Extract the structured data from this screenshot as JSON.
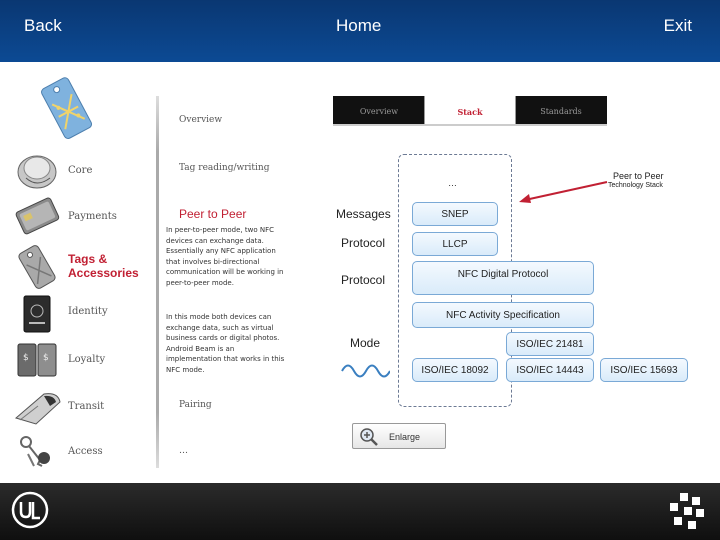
{
  "nav": {
    "back": "Back",
    "home": "Home",
    "exit": "Exit"
  },
  "sidebar": {
    "items": [
      {
        "label": "Core",
        "icon": "core-icon"
      },
      {
        "label": "Payments",
        "icon": "payments-icon"
      },
      {
        "label": "Tags & Accessories",
        "icon": "tags-icon"
      },
      {
        "label": "Identity",
        "icon": "identity-icon"
      },
      {
        "label": "Loyalty",
        "icon": "loyalty-icon"
      },
      {
        "label": "Transit",
        "icon": "transit-icon"
      },
      {
        "label": "Access",
        "icon": "access-icon"
      }
    ]
  },
  "middle": {
    "overview": "Overview",
    "tag_rw": "Tag reading/writing",
    "title": "Peer to Peer",
    "para1": "In peer-to-peer mode, two NFC devices can exchange data. Essentially any NFC application that involves bi-directional communication will be working in peer-to-peer mode.",
    "para2": "In this mode both devices can exchange data, such as virtual business cards or digital photos. Android Beam is an implementation that works in this NFC mode.",
    "pairing": "Pairing",
    "ellipsis": "…"
  },
  "tabs": [
    {
      "label": "Overview",
      "active": false
    },
    {
      "label": "Stack",
      "active": true
    },
    {
      "label": "Standards",
      "active": false
    }
  ],
  "diagram": {
    "top_ellipsis": "…",
    "layer_messages": "Messages",
    "layer_protocol1": "Protocol",
    "layer_protocol2": "Protocol",
    "layer_mode": "Mode",
    "snep": "SNEP",
    "llcp": "LLCP",
    "digital": "NFC Digital Protocol",
    "activity": "NFC Activity Specification",
    "iso21481": "ISO/IEC 21481",
    "iso18092": "ISO/IEC 18092",
    "iso14443": "ISO/IEC 14443",
    "iso15693": "ISO/IEC 15693",
    "p2p": "Peer to Peer",
    "tech_stack": "Technology Stack"
  },
  "enlarge": "Enlarge",
  "colors": {
    "accent_red": "#c12033",
    "header_blue": "#0b3f80",
    "box_border": "#7aa9d6"
  }
}
